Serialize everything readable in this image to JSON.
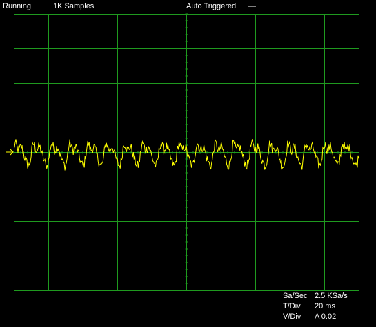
{
  "status_bar": {
    "run_state": "Running",
    "samples": "1K Samples",
    "trigger_mode": "Auto Triggered",
    "trigger_indicator": "—"
  },
  "screen": {
    "background_color": "#000000",
    "grid_color": "#1f9a1f",
    "trace_color": "#ffff00",
    "divisions_horizontal": 10,
    "divisions_vertical": 8,
    "marker_icon": "trigger-level-arrow-icon",
    "marker_color": "#ffff00"
  },
  "trace": {
    "description_visible": false,
    "samples": 500
  },
  "readouts": [
    {
      "label": "Sa/Sec",
      "value": "2.5 KSa/s"
    },
    {
      "label": "T/Div",
      "value": "20 ms"
    },
    {
      "label": "V/Div",
      "value": "A 0.02"
    }
  ]
}
